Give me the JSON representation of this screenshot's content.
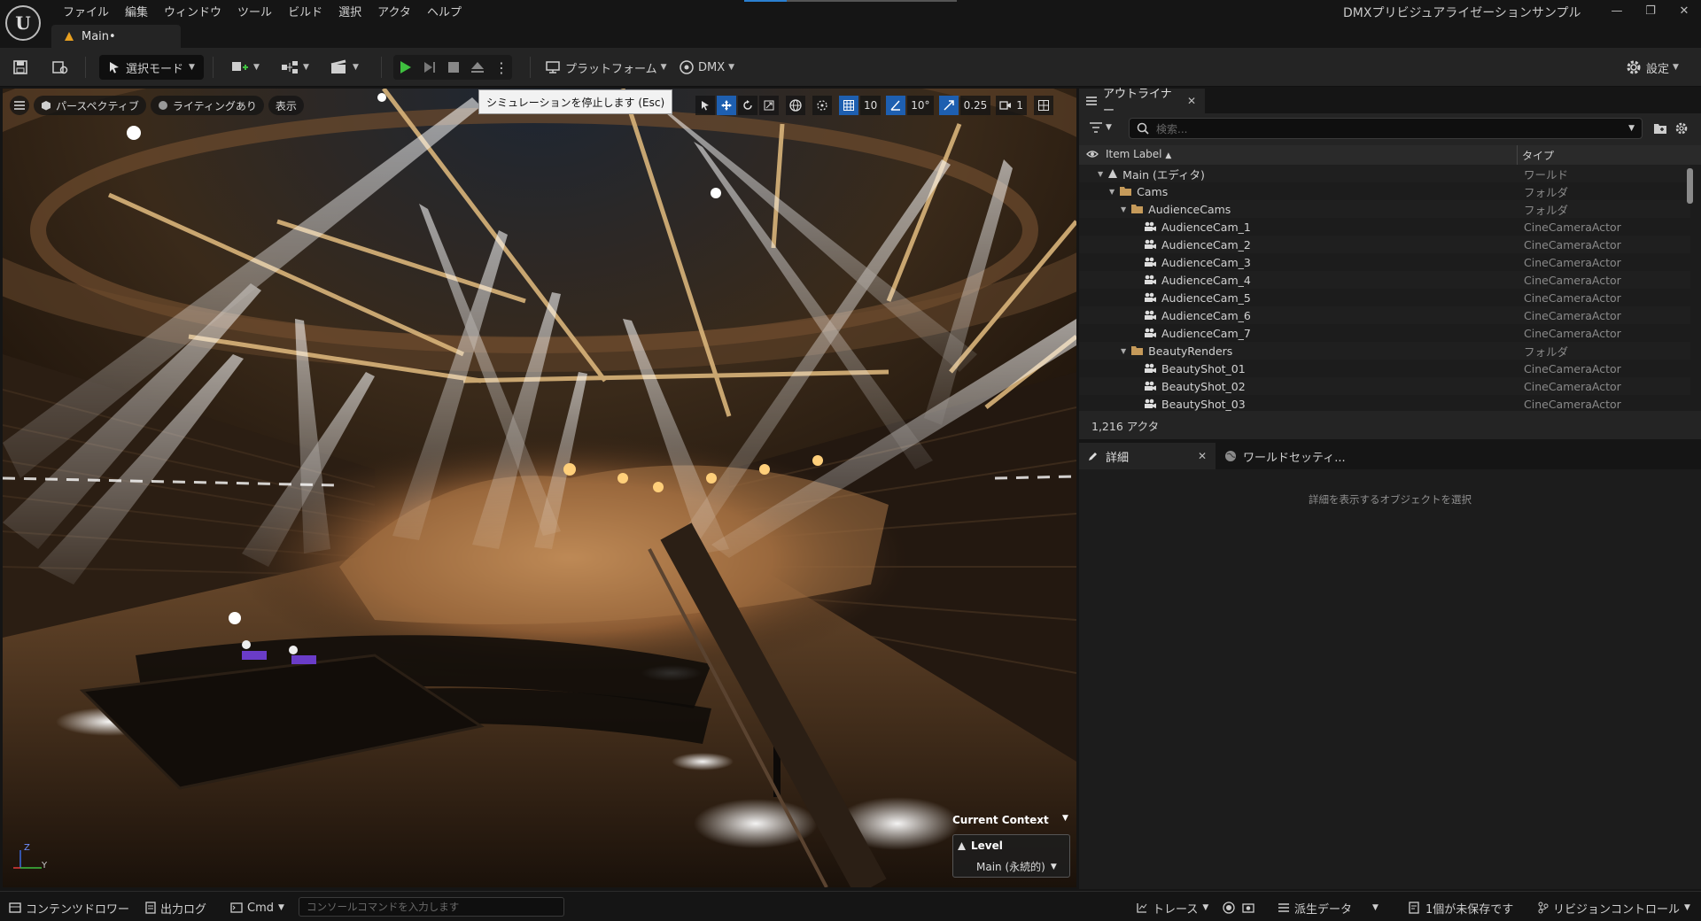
{
  "app": {
    "logo_letter": "U",
    "menu": [
      "ファイル",
      "編集",
      "ウィンドウ",
      "ツール",
      "ビルド",
      "選択",
      "アクタ",
      "ヘルプ"
    ],
    "title": "DMXプリビジュアライゼーションサンプル",
    "window_buttons": [
      "—",
      "❐",
      "✕"
    ]
  },
  "document_tab": {
    "label": "Main•"
  },
  "toolbar": {
    "mode_label": "選択モード",
    "platform_label": "プラットフォーム",
    "dmx_label": "DMX",
    "settings_label": "設定",
    "tooltip": "シミュレーションを停止します (Esc)"
  },
  "viewport": {
    "perspective_label": "パースペクティブ",
    "lighting_label": "ライティングあり",
    "show_label": "表示",
    "grid_snap": "10",
    "rotation_snap": "10°",
    "scale_snap": "0.25",
    "camera_speed": "1",
    "context_title": "Current Context",
    "context_level_label": "Level",
    "context_level_value": "Main (永続的)",
    "axis_z": "Z",
    "axis_y": "Y"
  },
  "outliner": {
    "tab_label": "アウトライナー",
    "search_placeholder": "検索...",
    "col_label": "Item Label",
    "col_type": "タイプ",
    "rows": [
      {
        "label": "Main (エディタ)",
        "type": "ワールド",
        "indent": 1,
        "kind": "world",
        "expanded": true
      },
      {
        "label": "Cams",
        "type": "フォルダ",
        "indent": 2,
        "kind": "folder",
        "expanded": true
      },
      {
        "label": "AudienceCams",
        "type": "フォルダ",
        "indent": 3,
        "kind": "folder",
        "expanded": true
      },
      {
        "label": "AudienceCam_1",
        "type": "CineCameraActor",
        "indent": 4,
        "kind": "camera"
      },
      {
        "label": "AudienceCam_2",
        "type": "CineCameraActor",
        "indent": 4,
        "kind": "camera"
      },
      {
        "label": "AudienceCam_3",
        "type": "CineCameraActor",
        "indent": 4,
        "kind": "camera"
      },
      {
        "label": "AudienceCam_4",
        "type": "CineCameraActor",
        "indent": 4,
        "kind": "camera"
      },
      {
        "label": "AudienceCam_5",
        "type": "CineCameraActor",
        "indent": 4,
        "kind": "camera"
      },
      {
        "label": "AudienceCam_6",
        "type": "CineCameraActor",
        "indent": 4,
        "kind": "camera"
      },
      {
        "label": "AudienceCam_7",
        "type": "CineCameraActor",
        "indent": 4,
        "kind": "camera"
      },
      {
        "label": "BeautyRenders",
        "type": "フォルダ",
        "indent": 3,
        "kind": "folder",
        "expanded": true
      },
      {
        "label": "BeautyShot_01",
        "type": "CineCameraActor",
        "indent": 4,
        "kind": "camera"
      },
      {
        "label": "BeautyShot_02",
        "type": "CineCameraActor",
        "indent": 4,
        "kind": "camera"
      },
      {
        "label": "BeautyShot_03",
        "type": "CineCameraActor",
        "indent": 4,
        "kind": "camera"
      }
    ],
    "actor_count": "1,216 アクタ"
  },
  "details": {
    "tab_label": "詳細",
    "world_settings_label": "ワールドセッティ...",
    "empty_message": "詳細を表示するオブジェクトを選択"
  },
  "statusbar": {
    "content_drawer": "コンテンツドロワー",
    "output_log": "出力ログ",
    "cmd_label": "Cmd",
    "console_placeholder": "コンソールコマンドを入力します",
    "trace_label": "トレース",
    "derived_data_label": "派生データ",
    "unsaved_label": "1個が未保存です",
    "revision_label": "リビジョンコントロール"
  },
  "colors": {
    "accent_blue": "#1e5fb0",
    "play_green": "#3fbf3f",
    "warning_orange": "#e8a020"
  }
}
